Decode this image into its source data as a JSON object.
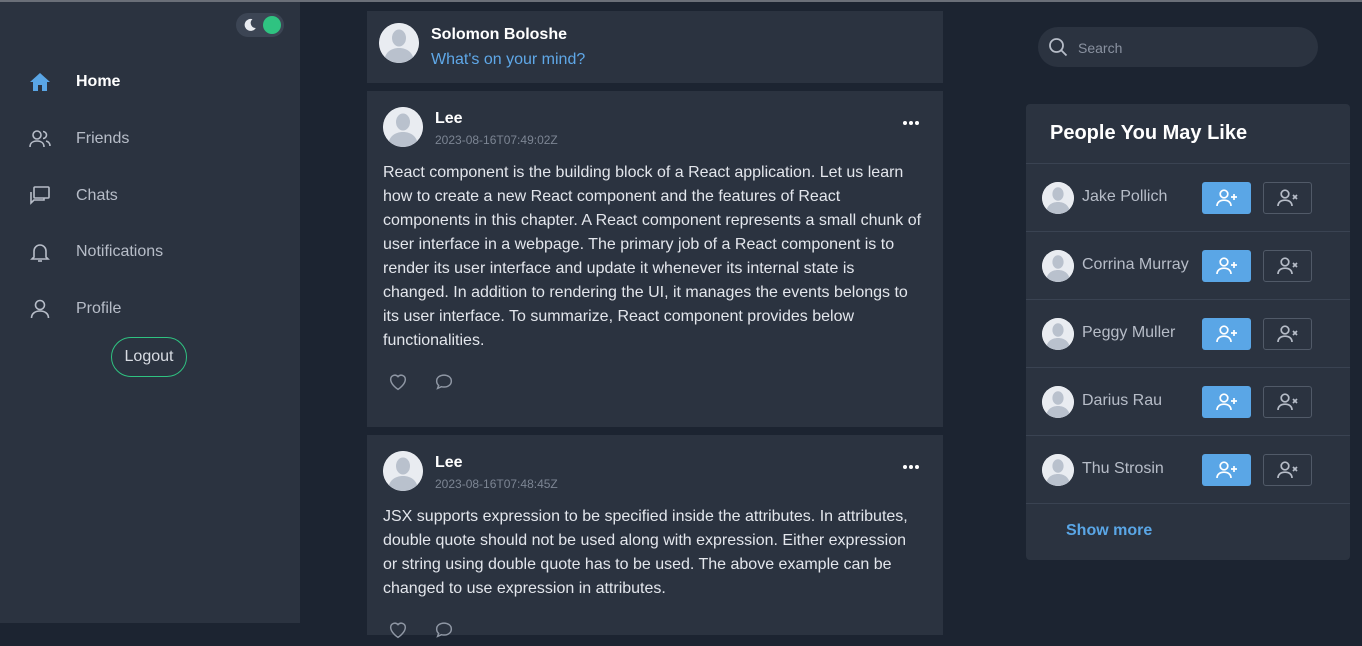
{
  "sidebar": {
    "items": [
      {
        "label": "Home",
        "icon": "home-icon",
        "active": true
      },
      {
        "label": "Friends",
        "icon": "friends-icon"
      },
      {
        "label": "Chats",
        "icon": "chats-icon"
      },
      {
        "label": "Notifications",
        "icon": "bell-icon"
      },
      {
        "label": "Profile",
        "icon": "profile-icon"
      }
    ],
    "logout_label": "Logout",
    "theme_toggle": {
      "icon": "moon-icon",
      "on": true
    }
  },
  "composer": {
    "name": "Solomon Boloshe",
    "prompt": "What's on your mind?"
  },
  "posts": [
    {
      "author": "Lee",
      "timestamp": "2023-08-16T07:49:02Z",
      "body": "React component is the building block of a React application. Let us learn how to create a new React component and the features of React components in this chapter. A React component represents a small chunk of user interface in a webpage. The primary job of a React component is to render its user interface and update it whenever its internal state is changed. In addition to rendering the UI, it manages the events belongs to its user interface. To summarize, React component provides below functionalities."
    },
    {
      "author": "Lee",
      "timestamp": "2023-08-16T07:48:45Z",
      "body": "JSX supports expression to be specified inside the attributes. In attributes, double quote should not be used along with expression. Either expression or string using double quote has to be used. The above example can be changed to use expression in attributes."
    }
  ],
  "search": {
    "placeholder": "Search"
  },
  "people": {
    "title": "People You May Like",
    "items": [
      {
        "name": "Jake Pollich"
      },
      {
        "name": "Corrina Murray"
      },
      {
        "name": "Peggy Muller"
      },
      {
        "name": "Darius Rau"
      },
      {
        "name": "Thu Strosin"
      }
    ],
    "show_more": "Show more"
  },
  "colors": {
    "accent_blue": "#5aa6e6",
    "accent_green": "#2fc381",
    "panel": "#2b3340",
    "background": "#1c2431"
  }
}
